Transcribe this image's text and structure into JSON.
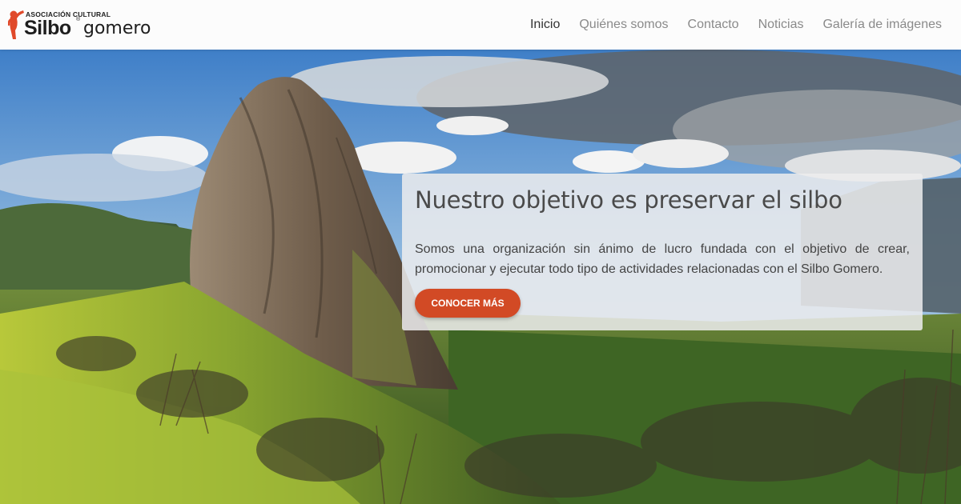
{
  "logo": {
    "top_line": "ASOCIACIÓN CULTURAL",
    "brand": "Silbo",
    "registered": "®",
    "suffix": "gomero",
    "accent_color": "#e0492a"
  },
  "nav": {
    "items": [
      {
        "label": "Inicio",
        "active": true
      },
      {
        "label": "Quiénes somos",
        "active": false
      },
      {
        "label": "Contacto",
        "active": false
      },
      {
        "label": "Noticias",
        "active": false
      },
      {
        "label": "Galería de imágenes",
        "active": false
      }
    ]
  },
  "hero": {
    "background": "landscape-photo-roque-agando",
    "title": "Nuestro objetivo es preservar el silbo",
    "text": "Somos una organización sin ánimo de lucro fundada con el objetivo de crear, promocionar y ejecutar todo tipo de actividades relacionadas con el Silbo Gomero.",
    "button_label": "CONOCER MÁS",
    "button_color": "#d24a25"
  }
}
